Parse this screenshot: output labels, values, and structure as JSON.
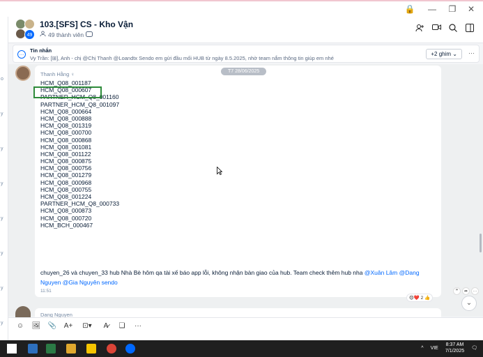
{
  "window": {
    "controls": [
      "🔒",
      "—",
      "❐",
      "✕"
    ]
  },
  "leftstrip": {
    "fragments": [
      "o",
      "y",
      "y",
      "y",
      "y",
      "y",
      "y",
      "y"
    ]
  },
  "header": {
    "group_avatar_badge": "49",
    "title": "103.[SFS] CS - Kho Vận",
    "members": "49 thành viên",
    "icons": [
      "add-member-icon",
      "video-call-icon",
      "search-icon",
      "sidebar-toggle-icon"
    ]
  },
  "pinned": {
    "title": "Tin nhắn",
    "text": "Vy Trần: [⊞], Anh - chị @Chị Thanh @Loandtx Sendo em gửi đầu mối HUB từ ngày 8.5.2025, nhờ team nắm thông tin giúp em nhé",
    "more_label": "+2 ghim",
    "more_arrow": "⌄",
    "dots": "···"
  },
  "message": {
    "date_chip": "T7 28/06/2025",
    "sender": "Thanh Hằng",
    "sender_suffix": "♀",
    "lines": [
      "HCM_Q08_001187",
      "HCM_Q08_000607",
      "PARTNER_HCM_Q8_001160",
      "PARTNER_HCM_Q8_001097",
      "HCM_Q08_000664",
      "HCM_Q08_000888",
      "HCM_Q08_001319",
      "HCM_Q08_000700",
      "HCM_Q08_000868",
      "HCM_Q08_001081",
      "HCM_Q08_001122",
      "HCM_Q08_000875",
      "HCM_Q08_000756",
      "HCM_Q08_001279",
      "HCM_Q08_000968",
      "HCM_Q08_000755",
      "HCM_Q08_001224",
      "PARTNER_HCM_Q8_000733",
      "HCM_Q08_000873",
      "HCM_Q08_000720",
      "HCM_BCH_000467"
    ],
    "body_text": "chuyen_26 và chuyen_33 hub Nhà Bè hôm qa tài xế báo app lỗi, không nhận bàn giao của hub. Team check thêm hub nha ",
    "mention_1": "@Xuân Lâm",
    "mention_2": "@Dang Nguyen",
    "mention_3": "@Gia Nguyên sendo",
    "time": "11:51",
    "reactions": "😄❤️ 2",
    "reaction_like": "👍"
  },
  "next_message": {
    "sender": "Dang Nguyen"
  },
  "side_actions": [
    "❞",
    "➦",
    "···"
  ],
  "scroll_down_icon": "⌄",
  "toolbar": {
    "icons": [
      "☺",
      "🖼",
      "📎",
      "A+",
      "⊡▾",
      "A̷",
      "❏",
      "···"
    ]
  },
  "taskbar": {
    "lang": "VIE",
    "time": "8:37 AM",
    "date": "7/1/2025",
    "chevron": "^",
    "notif": "🗨"
  },
  "colors": {
    "accent": "#0068ff",
    "highlight": "#2e8b3a"
  }
}
